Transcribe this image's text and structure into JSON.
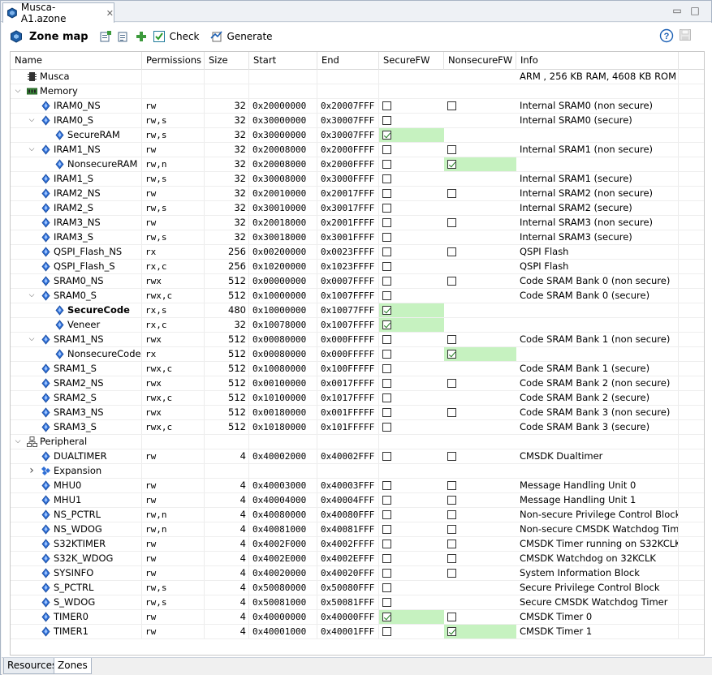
{
  "window": {
    "tab_title": "Musca-A1.azone",
    "close_glyph": "✕",
    "minimize_glyph": "▭",
    "maximize_glyph": "□"
  },
  "toolbar": {
    "title": "Zone map",
    "check_label": "Check",
    "generate_label": "Generate",
    "help_glyph": "?"
  },
  "columns": [
    "Name",
    "Permissions",
    "Size",
    "Start",
    "End",
    "SecureFW",
    "NonsecureFW",
    "Info"
  ],
  "rows": [
    {
      "level": 0,
      "arrow": "",
      "icon": "chip",
      "name": "Musca",
      "perm": "",
      "size": "",
      "start": "",
      "end": "",
      "sfw": null,
      "nsfw": null,
      "info": "ARM , 256 KB RAM, 4608 KB ROM",
      "bold": false
    },
    {
      "level": 0,
      "arrow": "down",
      "icon": "memory",
      "name": "Memory",
      "perm": "",
      "size": "",
      "start": "",
      "end": "",
      "sfw": null,
      "nsfw": null,
      "info": "",
      "bold": false
    },
    {
      "level": 1,
      "arrow": "",
      "icon": "diamond",
      "name": "IRAM0_NS",
      "perm": "rw",
      "size": "32",
      "start": "0x20000000",
      "end": "0x20007FFF",
      "sfw": false,
      "nsfw": false,
      "info": "Internal SRAM0 (non secure)",
      "bold": false
    },
    {
      "level": 1,
      "arrow": "down",
      "icon": "diamond",
      "name": "IRAM0_S",
      "perm": "rw,s",
      "size": "32",
      "start": "0x30000000",
      "end": "0x30007FFF",
      "sfw": false,
      "nsfw": null,
      "info": "Internal SRAM0 (secure)",
      "bold": false
    },
    {
      "level": 2,
      "arrow": "",
      "icon": "diamond",
      "name": "SecureRAM",
      "perm": "rw,s",
      "size": "32",
      "start": "0x30000000",
      "end": "0x30007FFF",
      "sfw": true,
      "nsfw": null,
      "info": "",
      "bold": false,
      "hl": "sfw"
    },
    {
      "level": 1,
      "arrow": "down",
      "icon": "diamond",
      "name": "IRAM1_NS",
      "perm": "rw",
      "size": "32",
      "start": "0x20008000",
      "end": "0x2000FFFF",
      "sfw": false,
      "nsfw": false,
      "info": "Internal SRAM1 (non secure)",
      "bold": false
    },
    {
      "level": 2,
      "arrow": "",
      "icon": "diamond",
      "name": "NonsecureRAM",
      "perm": "rw,n",
      "size": "32",
      "start": "0x20008000",
      "end": "0x2000FFFF",
      "sfw": false,
      "nsfw": true,
      "info": "",
      "bold": false,
      "hl": "nsfw"
    },
    {
      "level": 1,
      "arrow": "",
      "icon": "diamond",
      "name": "IRAM1_S",
      "perm": "rw,s",
      "size": "32",
      "start": "0x30008000",
      "end": "0x3000FFFF",
      "sfw": false,
      "nsfw": null,
      "info": "Internal SRAM1 (secure)",
      "bold": false
    },
    {
      "level": 1,
      "arrow": "",
      "icon": "diamond",
      "name": "IRAM2_NS",
      "perm": "rw",
      "size": "32",
      "start": "0x20010000",
      "end": "0x20017FFF",
      "sfw": false,
      "nsfw": false,
      "info": "Internal SRAM2 (non secure)",
      "bold": false
    },
    {
      "level": 1,
      "arrow": "",
      "icon": "diamond",
      "name": "IRAM2_S",
      "perm": "rw,s",
      "size": "32",
      "start": "0x30010000",
      "end": "0x30017FFF",
      "sfw": false,
      "nsfw": null,
      "info": "Internal SRAM2 (secure)",
      "bold": false
    },
    {
      "level": 1,
      "arrow": "",
      "icon": "diamond",
      "name": "IRAM3_NS",
      "perm": "rw",
      "size": "32",
      "start": "0x20018000",
      "end": "0x2001FFFF",
      "sfw": false,
      "nsfw": false,
      "info": "Internal SRAM3 (non secure)",
      "bold": false
    },
    {
      "level": 1,
      "arrow": "",
      "icon": "diamond",
      "name": "IRAM3_S",
      "perm": "rw,s",
      "size": "32",
      "start": "0x30018000",
      "end": "0x3001FFFF",
      "sfw": false,
      "nsfw": null,
      "info": "Internal SRAM3 (secure)",
      "bold": false
    },
    {
      "level": 1,
      "arrow": "",
      "icon": "diamond",
      "name": "QSPI_Flash_NS",
      "perm": "rx",
      "size": "256",
      "start": "0x00200000",
      "end": "0x0023FFFF",
      "sfw": false,
      "nsfw": false,
      "info": "QSPI Flash",
      "bold": false
    },
    {
      "level": 1,
      "arrow": "",
      "icon": "diamond",
      "name": "QSPI_Flash_S",
      "perm": "rx,c",
      "size": "256",
      "start": "0x10200000",
      "end": "0x1023FFFF",
      "sfw": false,
      "nsfw": null,
      "info": "QSPI Flash",
      "bold": false
    },
    {
      "level": 1,
      "arrow": "",
      "icon": "diamond",
      "name": "SRAM0_NS",
      "perm": "rwx",
      "size": "512",
      "start": "0x00000000",
      "end": "0x0007FFFF",
      "sfw": false,
      "nsfw": false,
      "info": "Code SRAM Bank 0 (non secure)",
      "bold": false
    },
    {
      "level": 1,
      "arrow": "down",
      "icon": "diamond",
      "name": "SRAM0_S",
      "perm": "rwx,c",
      "size": "512",
      "start": "0x10000000",
      "end": "0x1007FFFF",
      "sfw": false,
      "nsfw": null,
      "info": "Code SRAM Bank 0 (secure)",
      "bold": false
    },
    {
      "level": 2,
      "arrow": "",
      "icon": "diamond",
      "name": "SecureCode",
      "perm": "rx,s",
      "size": "480",
      "start": "0x10000000",
      "end": "0x10077FFF",
      "sfw": true,
      "nsfw": null,
      "info": "",
      "bold": true,
      "hl": "sfw"
    },
    {
      "level": 2,
      "arrow": "",
      "icon": "diamond",
      "name": "Veneer",
      "perm": "rx,c",
      "size": "32",
      "start": "0x10078000",
      "end": "0x1007FFFF",
      "sfw": true,
      "nsfw": null,
      "info": "",
      "bold": false,
      "hl": "sfw"
    },
    {
      "level": 1,
      "arrow": "down",
      "icon": "diamond",
      "name": "SRAM1_NS",
      "perm": "rwx",
      "size": "512",
      "start": "0x00080000",
      "end": "0x000FFFFF",
      "sfw": false,
      "nsfw": false,
      "info": "Code SRAM Bank 1 (non secure)",
      "bold": false
    },
    {
      "level": 2,
      "arrow": "",
      "icon": "diamond",
      "name": "NonsecureCode",
      "perm": "rx",
      "size": "512",
      "start": "0x00080000",
      "end": "0x000FFFFF",
      "sfw": false,
      "nsfw": true,
      "info": "",
      "bold": false,
      "hl": "nsfw"
    },
    {
      "level": 1,
      "arrow": "",
      "icon": "diamond",
      "name": "SRAM1_S",
      "perm": "rwx,c",
      "size": "512",
      "start": "0x10080000",
      "end": "0x100FFFFF",
      "sfw": false,
      "nsfw": null,
      "info": "Code SRAM Bank 1 (secure)",
      "bold": false
    },
    {
      "level": 1,
      "arrow": "",
      "icon": "diamond",
      "name": "SRAM2_NS",
      "perm": "rwx",
      "size": "512",
      "start": "0x00100000",
      "end": "0x0017FFFF",
      "sfw": false,
      "nsfw": false,
      "info": "Code SRAM Bank 2 (non secure)",
      "bold": false
    },
    {
      "level": 1,
      "arrow": "",
      "icon": "diamond",
      "name": "SRAM2_S",
      "perm": "rwx,c",
      "size": "512",
      "start": "0x10100000",
      "end": "0x1017FFFF",
      "sfw": false,
      "nsfw": null,
      "info": "Code SRAM Bank 2 (secure)",
      "bold": false
    },
    {
      "level": 1,
      "arrow": "",
      "icon": "diamond",
      "name": "SRAM3_NS",
      "perm": "rwx",
      "size": "512",
      "start": "0x00180000",
      "end": "0x001FFFFF",
      "sfw": false,
      "nsfw": false,
      "info": "Code SRAM Bank 3 (non secure)",
      "bold": false
    },
    {
      "level": 1,
      "arrow": "",
      "icon": "diamond",
      "name": "SRAM3_S",
      "perm": "rwx,c",
      "size": "512",
      "start": "0x10180000",
      "end": "0x101FFFFF",
      "sfw": false,
      "nsfw": null,
      "info": "Code SRAM Bank 3 (secure)",
      "bold": false
    },
    {
      "level": 0,
      "arrow": "down",
      "icon": "peripheral",
      "name": "Peripheral",
      "perm": "",
      "size": "",
      "start": "",
      "end": "",
      "sfw": null,
      "nsfw": null,
      "info": "",
      "bold": false
    },
    {
      "level": 1,
      "arrow": "",
      "icon": "diamond",
      "name": "DUALTIMER",
      "perm": "rw",
      "size": "4",
      "start": "0x40002000",
      "end": "0x40002FFF",
      "sfw": false,
      "nsfw": false,
      "info": "CMSDK Dualtimer",
      "bold": false
    },
    {
      "level": 1,
      "arrow": "right",
      "icon": "multi",
      "name": "Expansion",
      "perm": "",
      "size": "",
      "start": "",
      "end": "",
      "sfw": null,
      "nsfw": null,
      "info": "",
      "bold": false
    },
    {
      "level": 1,
      "arrow": "",
      "icon": "diamond",
      "name": "MHU0",
      "perm": "rw",
      "size": "4",
      "start": "0x40003000",
      "end": "0x40003FFF",
      "sfw": false,
      "nsfw": false,
      "info": "Message Handling Unit 0",
      "bold": false
    },
    {
      "level": 1,
      "arrow": "",
      "icon": "diamond",
      "name": "MHU1",
      "perm": "rw",
      "size": "4",
      "start": "0x40004000",
      "end": "0x40004FFF",
      "sfw": false,
      "nsfw": false,
      "info": "Message Handling Unit 1",
      "bold": false
    },
    {
      "level": 1,
      "arrow": "",
      "icon": "diamond",
      "name": "NS_PCTRL",
      "perm": "rw,n",
      "size": "4",
      "start": "0x40080000",
      "end": "0x40080FFF",
      "sfw": false,
      "nsfw": false,
      "info": "Non-secure Privilege Control Block",
      "bold": false
    },
    {
      "level": 1,
      "arrow": "",
      "icon": "diamond",
      "name": "NS_WDOG",
      "perm": "rw,n",
      "size": "4",
      "start": "0x40081000",
      "end": "0x40081FFF",
      "sfw": false,
      "nsfw": false,
      "info": "Non-secure CMSDK Watchdog Time",
      "bold": false
    },
    {
      "level": 1,
      "arrow": "",
      "icon": "diamond",
      "name": "S32KTIMER",
      "perm": "rw",
      "size": "4",
      "start": "0x4002F000",
      "end": "0x4002FFFF",
      "sfw": false,
      "nsfw": false,
      "info": "CMSDK Timer running on S32KCLK",
      "bold": false
    },
    {
      "level": 1,
      "arrow": "",
      "icon": "diamond",
      "name": "S32K_WDOG",
      "perm": "rw",
      "size": "4",
      "start": "0x4002E000",
      "end": "0x4002EFFF",
      "sfw": false,
      "nsfw": false,
      "info": "CMSDK Watchdog on 32KCLK",
      "bold": false
    },
    {
      "level": 1,
      "arrow": "",
      "icon": "diamond",
      "name": "SYSINFO",
      "perm": "rw",
      "size": "4",
      "start": "0x40020000",
      "end": "0x40020FFF",
      "sfw": false,
      "nsfw": false,
      "info": "System Information Block",
      "bold": false
    },
    {
      "level": 1,
      "arrow": "",
      "icon": "diamond",
      "name": "S_PCTRL",
      "perm": "rw,s",
      "size": "4",
      "start": "0x50080000",
      "end": "0x50080FFF",
      "sfw": false,
      "nsfw": null,
      "info": "Secure Privilege Control Block",
      "bold": false
    },
    {
      "level": 1,
      "arrow": "",
      "icon": "diamond",
      "name": "S_WDOG",
      "perm": "rw,s",
      "size": "4",
      "start": "0x50081000",
      "end": "0x50081FFF",
      "sfw": false,
      "nsfw": null,
      "info": "Secure CMSDK Watchdog Timer",
      "bold": false
    },
    {
      "level": 1,
      "arrow": "",
      "icon": "diamond",
      "name": "TIMER0",
      "perm": "rw",
      "size": "4",
      "start": "0x40000000",
      "end": "0x40000FFF",
      "sfw": true,
      "nsfw": false,
      "info": "CMSDK Timer 0",
      "bold": false,
      "hl": "sfw"
    },
    {
      "level": 1,
      "arrow": "",
      "icon": "diamond",
      "name": "TIMER1",
      "perm": "rw",
      "size": "4",
      "start": "0x40001000",
      "end": "0x40001FFF",
      "sfw": false,
      "nsfw": true,
      "info": "CMSDK Timer 1",
      "bold": false,
      "hl": "nsfw"
    }
  ],
  "bottom_tabs": [
    "Resources",
    "Zones"
  ],
  "colors": {
    "highlight": "#c6f2c0",
    "diamond": "#2f6fd6",
    "toolbar_icon": "#1a5fb4"
  }
}
